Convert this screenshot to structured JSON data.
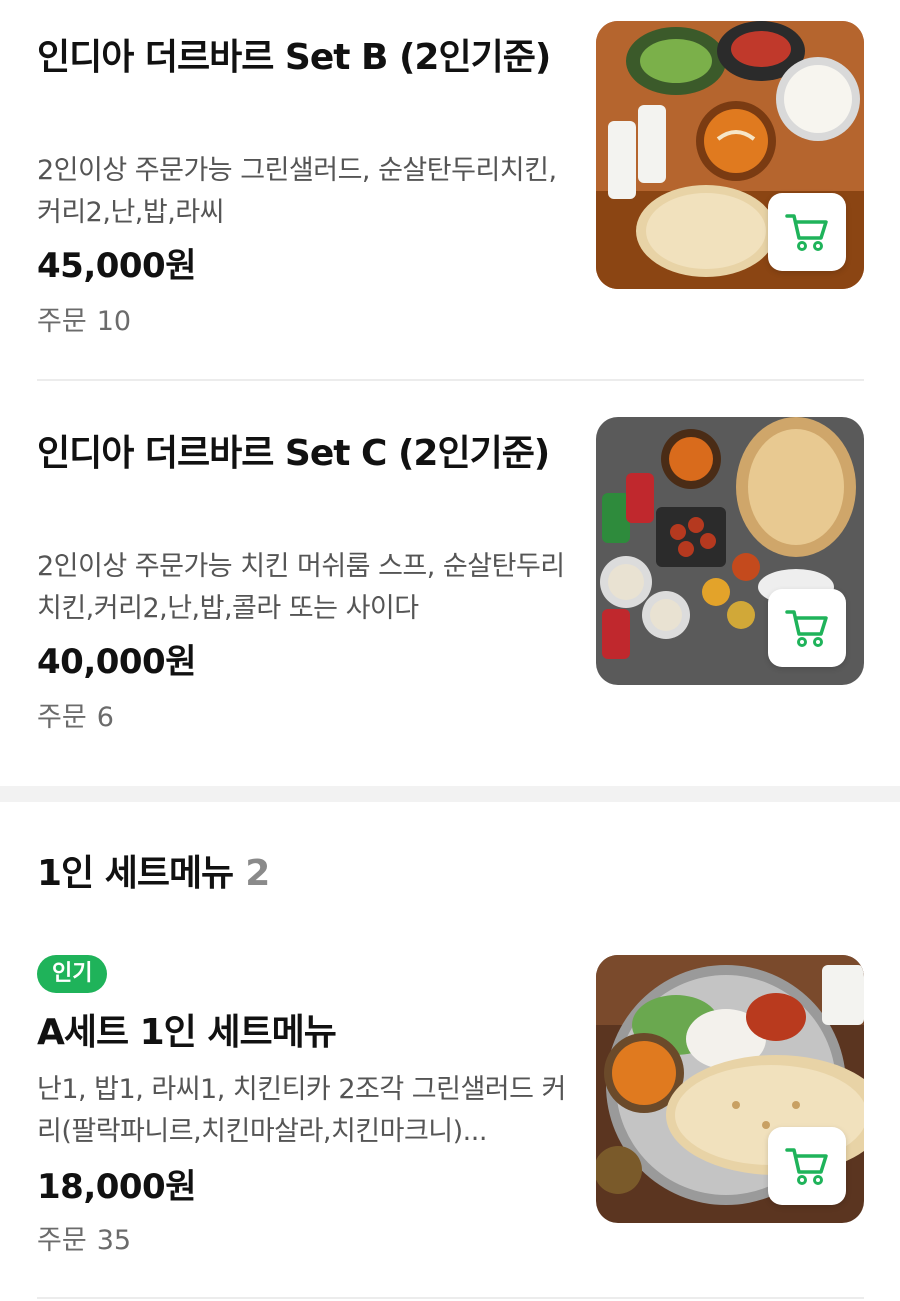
{
  "section_set2": {
    "items": [
      {
        "title": "인디아 더르바르 Set B (2인기준)",
        "description": "2인이상 주문가능 그린샐러드, 순살탄두리치킨,커리2,난,밥,라씨",
        "price": "45,000원",
        "orders_label": "주문",
        "orders_count": "10",
        "image_icon": "food-photo",
        "cart_icon": "cart-icon"
      },
      {
        "title": "인디아 더르바르 Set C (2인기준)",
        "description": "2인이상 주문가능 치킨 머쉬룸 스프, 순살탄두리치킨,커리2,난,밥,콜라 또는 사이다",
        "price": "40,000원",
        "orders_label": "주문",
        "orders_count": "6",
        "image_icon": "food-photo",
        "cart_icon": "cart-icon"
      }
    ]
  },
  "section_single": {
    "title": "1인 세트메뉴",
    "count": "2",
    "items": [
      {
        "badge": "인기",
        "title": "A세트 1인 세트메뉴",
        "description": "난1, 밥1, 라씨1, 치킨티카 2조각 그린샐러드 커리(팔락파니르,치킨마살라,치킨마크니)...",
        "price": "18,000원",
        "orders_label": "주문",
        "orders_count": "35",
        "image_icon": "food-photo",
        "cart_icon": "cart-icon"
      }
    ]
  },
  "colors": {
    "accent_green": "#1fb35a",
    "text_primary": "#111111",
    "text_secondary": "#555555",
    "text_muted": "#6b6b6b",
    "divider": "#ececec",
    "section_gap": "#f2f2f2"
  }
}
